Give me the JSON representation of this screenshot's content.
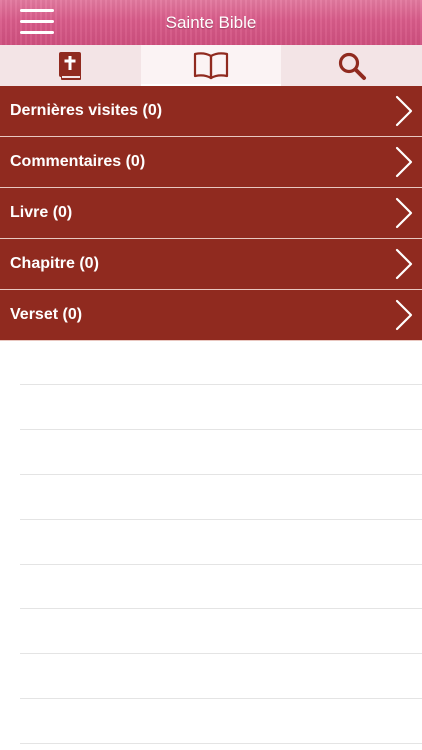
{
  "header": {
    "title": "Sainte Bible",
    "menu_icon": "hamburger-menu-icon",
    "background_color": "#d95c8a"
  },
  "tabs": [
    {
      "icon": "bible-book-icon",
      "active": false
    },
    {
      "icon": "open-book-icon",
      "active": true
    },
    {
      "icon": "search-icon",
      "active": false
    }
  ],
  "accent_color": "#902a1f",
  "list": [
    {
      "label": "Dernières visites (0)",
      "icon": "chevron-right-icon"
    },
    {
      "label": "Commentaires (0)",
      "icon": "chevron-right-icon"
    },
    {
      "label": "Livre (0)",
      "icon": "chevron-right-icon"
    },
    {
      "label": "Chapitre (0)",
      "icon": "chevron-right-icon"
    },
    {
      "label": "Verset (0)",
      "icon": "chevron-right-icon"
    }
  ]
}
